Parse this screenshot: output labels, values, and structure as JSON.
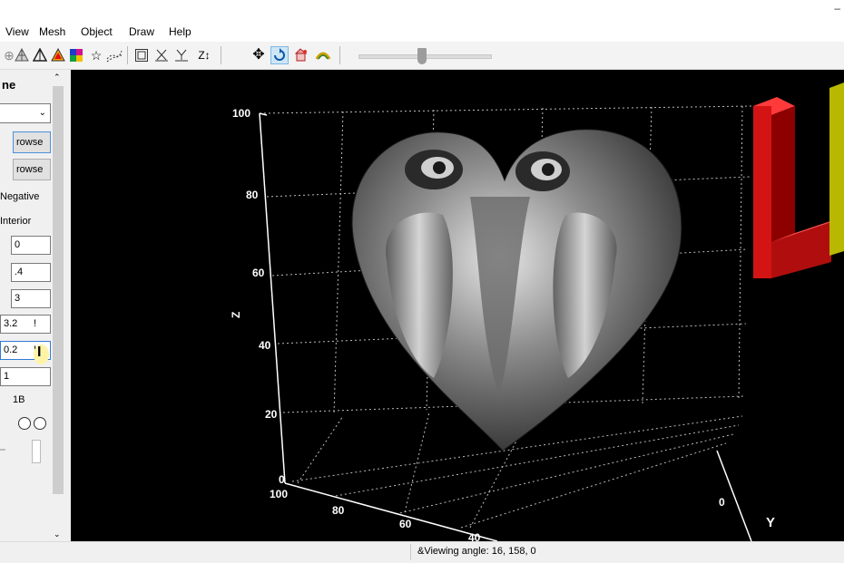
{
  "menu": {
    "items": [
      "View",
      "Mesh",
      "Object",
      "Draw",
      "Help"
    ]
  },
  "window": {
    "minimize_glyph": "–"
  },
  "toolbar": {
    "icons": [
      "grid-mesh-icon",
      "shaded-mesh-icon",
      "outline-triangle-icon",
      "color-triangle-icon",
      "color-patch-icon",
      "star-icon",
      "dots-icon",
      "box-icon",
      "xy-axis-icon",
      "yx-axis-icon",
      "zt-axis-icon",
      "move-icon",
      "rotate-icon",
      "light-icon",
      "arc-icon"
    ],
    "zt_label": "Z↕",
    "slider_value": 0.45
  },
  "left_panel": {
    "heading": "ne",
    "browse_1": "rowse",
    "browse_2": "rowse",
    "negative_label": "Negative",
    "interior_label": "Interior",
    "field_1": "0",
    "field_2": ".4",
    "field_3": "3",
    "field_4": "3.2",
    "field_4_suffix": "!",
    "field_5": "0.2",
    "field_5_suffix": "!",
    "field_6": "1",
    "label_1b": "1B",
    "cursor_glyph": "I"
  },
  "viewport": {
    "z_ticks": [
      "100",
      "80",
      "60",
      "40",
      "20",
      "0"
    ],
    "x_ticks": [
      "100",
      "80",
      "60",
      "40"
    ],
    "y_ticks": [
      "0"
    ],
    "z_axis_label": "Z",
    "y_axis_label": "Y",
    "background": "#000000",
    "logo_colors": [
      "#cc1010",
      "#e6e600"
    ]
  },
  "status": {
    "text": "&Viewing angle: 16, 158, 0"
  }
}
